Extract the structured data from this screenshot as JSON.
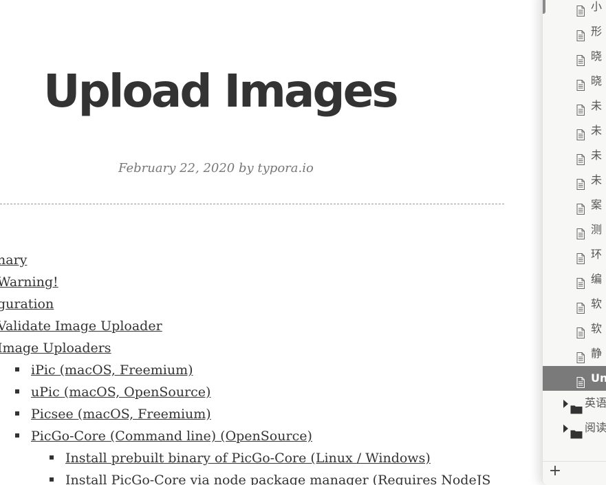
{
  "document": {
    "title": "Upload Images",
    "meta": "February 22, 2020 by typora.io",
    "toc": [
      {
        "text": "nary",
        "level": 1
      },
      {
        "text": "Warning!",
        "level": 1
      },
      {
        "text": "guration",
        "level": 1
      },
      {
        "text": "Validate Image Uploader",
        "level": 1
      },
      {
        "text": "Image Uploaders",
        "level": 1
      },
      {
        "text": "iPic (macOS, Freemium)",
        "level": 2
      },
      {
        "text": "uPic (macOS, OpenSource)",
        "level": 2
      },
      {
        "text": "Picsee (macOS, Freemium)",
        "level": 2
      },
      {
        "text": "PicGo-Core (Command line) (OpenSource)",
        "level": 2
      },
      {
        "text": "Install prebuilt binary of PicGo-Core (Linux / Windows)",
        "level": 3
      },
      {
        "text": "Install PicGo-Core via node package manager (Requires NodeJS",
        "level": 3
      }
    ]
  },
  "sidebar": {
    "files": [
      {
        "label": "小",
        "active": false
      },
      {
        "label": "形",
        "active": false
      },
      {
        "label": "晓",
        "active": false
      },
      {
        "label": "晓",
        "active": false
      },
      {
        "label": "未",
        "active": false
      },
      {
        "label": "未",
        "active": false
      },
      {
        "label": "未",
        "active": false
      },
      {
        "label": "未",
        "active": false
      },
      {
        "label": "案",
        "active": false
      },
      {
        "label": "测",
        "active": false
      },
      {
        "label": "环",
        "active": false
      },
      {
        "label": "编",
        "active": false
      },
      {
        "label": "软",
        "active": false
      },
      {
        "label": "软",
        "active": false
      },
      {
        "label": "静",
        "active": false
      },
      {
        "label": "Un",
        "active": true
      }
    ],
    "folders": [
      {
        "label": "英语"
      },
      {
        "label": "阅读"
      }
    ],
    "add_label": "+"
  }
}
